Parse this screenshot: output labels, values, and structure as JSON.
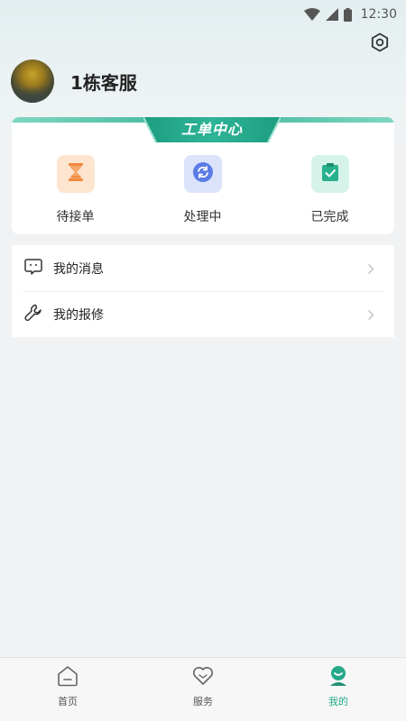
{
  "status_bar": {
    "time": "12:30",
    "icons": [
      "wifi-icon",
      "signal-icon",
      "battery-icon"
    ]
  },
  "header": {
    "settings_icon": "settings-icon"
  },
  "profile": {
    "name": "1栋客服",
    "avatar": "avatar-photo"
  },
  "work_order": {
    "title": "工单中心",
    "items": [
      {
        "label": "待接单",
        "icon": "hourglass-icon",
        "bg": "#fde5d0",
        "color": "#f08a3c"
      },
      {
        "label": "处理中",
        "icon": "refresh-icon",
        "bg": "#dbe3fb",
        "color": "#5b7be6"
      },
      {
        "label": "已完成",
        "icon": "clipboard-check-icon",
        "bg": "#d6f3ea",
        "color": "#27b28d"
      }
    ]
  },
  "menu": [
    {
      "label": "我的消息",
      "icon": "message-icon"
    },
    {
      "label": "我的报修",
      "icon": "wrench-icon"
    }
  ],
  "tab_bar": {
    "tabs": [
      {
        "label": "首页",
        "icon": "home-icon",
        "active": false
      },
      {
        "label": "服务",
        "icon": "heart-icon",
        "active": false
      },
      {
        "label": "我的",
        "icon": "user-icon",
        "active": true
      }
    ],
    "accent": "#25a889"
  }
}
